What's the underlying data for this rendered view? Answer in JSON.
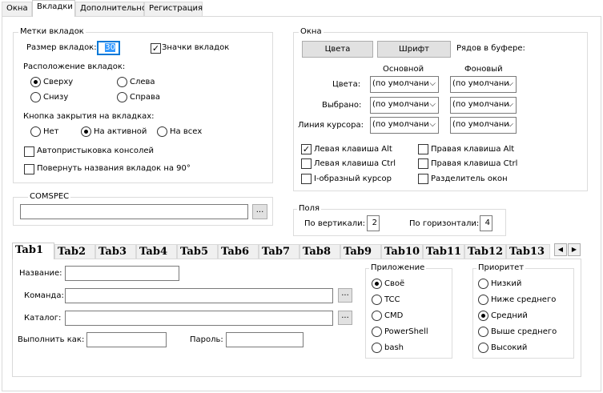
{
  "top_tabs": [
    "Окна",
    "Вкладки",
    "Дополнительно",
    "Регистрация"
  ],
  "tab_labels": {
    "title": "Метки вкладок",
    "size_label": "Размер вкладок:",
    "size_value": "30",
    "icons_label": "Значки вкладок",
    "position_title": "Расположение вкладок:",
    "pos_top": "Сверху",
    "pos_left": "Слева",
    "pos_bottom": "Снизу",
    "pos_right": "Справа",
    "close_title": "Кнопка закрытия на вкладках:",
    "close_none": "Нет",
    "close_active": "На активной",
    "close_all": "На всех",
    "autodock": "Автопристыковка консолей",
    "rotate": "Повернуть названия вкладок на 90°"
  },
  "comspec": {
    "title": "COMSPEC",
    "value": "",
    "browse": "..."
  },
  "windows": {
    "title": "Окна",
    "colors_btn": "Цвета",
    "font_btn": "Шрифт",
    "rows_label": "Рядов в буфере:",
    "col_main": "Основной",
    "col_bg": "Фоновый",
    "row_colors": "Цвета:",
    "row_selected": "Выбрано:",
    "row_cursor": "Линия курсора:",
    "default_value": "(по умолчани",
    "left_alt": "Левая клавиша Alt",
    "right_alt": "Правая клавиша Alt",
    "left_ctrl": "Левая клавиша Ctrl",
    "right_ctrl": "Правая клавиша Ctrl",
    "ibeam": "I-образный курсор",
    "separator": "Разделитель окон"
  },
  "margins": {
    "title": "Поля",
    "vert_label": "По вертикали:",
    "vert_value": "2",
    "horiz_label": "По горизонтали:",
    "horiz_value": "4"
  },
  "bottom_tabs": [
    "Tab1",
    "Tab2",
    "Tab3",
    "Tab4",
    "Tab5",
    "Tab6",
    "Tab7",
    "Tab8",
    "Tab9",
    "Tab10",
    "Tab11",
    "Tab12",
    "Tab13"
  ],
  "scroll": {
    "left": "◀",
    "right": "▶"
  },
  "task": {
    "name_label": "Название:",
    "command_label": "Команда:",
    "dir_label": "Каталог:",
    "runas_label": "Выполнить как:",
    "password_label": "Пароль:",
    "browse": "...",
    "name_value": "",
    "command_value": "",
    "dir_value": "",
    "runas_value": "",
    "password_value": ""
  },
  "app": {
    "title": "Приложение",
    "items": [
      "Своё",
      "TCC",
      "CMD",
      "PowerShell",
      "bash"
    ]
  },
  "priority": {
    "title": "Приоритет",
    "items": [
      "Низкий",
      "Ниже среднего",
      "Средний",
      "Выше среднего",
      "Высокий"
    ]
  }
}
